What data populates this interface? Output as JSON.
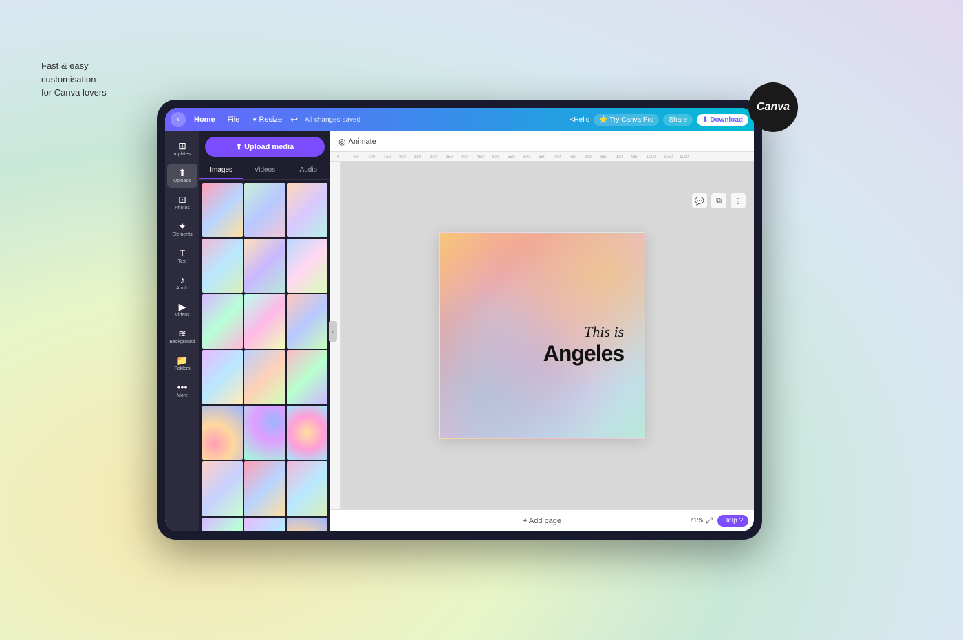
{
  "tagline": {
    "line1": "Fast & easy",
    "line2": "customisation",
    "line3": "for Canva lovers"
  },
  "canva_badge": {
    "text": "Canva"
  },
  "toolbar": {
    "back_label": "‹",
    "home_label": "Home",
    "file_label": "File",
    "resize_label": "Resize",
    "undo_label": "↩",
    "saved_label": "All changes saved",
    "hello_label": "<Hello",
    "try_pro_label": "⭐ Try Canva Pro",
    "share_label": "Share",
    "download_label": "⬇ Download"
  },
  "sidebar": {
    "items": [
      {
        "icon": "⊞",
        "label": "mplates"
      },
      {
        "icon": "⬆",
        "label": "Uploads"
      },
      {
        "icon": "⊡",
        "label": "Photos"
      },
      {
        "icon": "✦",
        "label": "Elements"
      },
      {
        "icon": "T",
        "label": "Text"
      },
      {
        "icon": "♪",
        "label": "Audio"
      },
      {
        "icon": "▶",
        "label": "Videos"
      },
      {
        "icon": "≡",
        "label": "Background"
      },
      {
        "icon": "📁",
        "label": "Folders"
      },
      {
        "icon": "•••",
        "label": "More"
      }
    ]
  },
  "upload_panel": {
    "upload_btn_label": "⬆ Upload media",
    "tabs": [
      "Images",
      "Videos",
      "Audio"
    ]
  },
  "canvas": {
    "animate_label": "Animate",
    "text_top": "This is",
    "text_bottom": "Angeles",
    "add_page_label": "+ Add page",
    "zoom_label": "71%",
    "help_label": "Help ?"
  }
}
